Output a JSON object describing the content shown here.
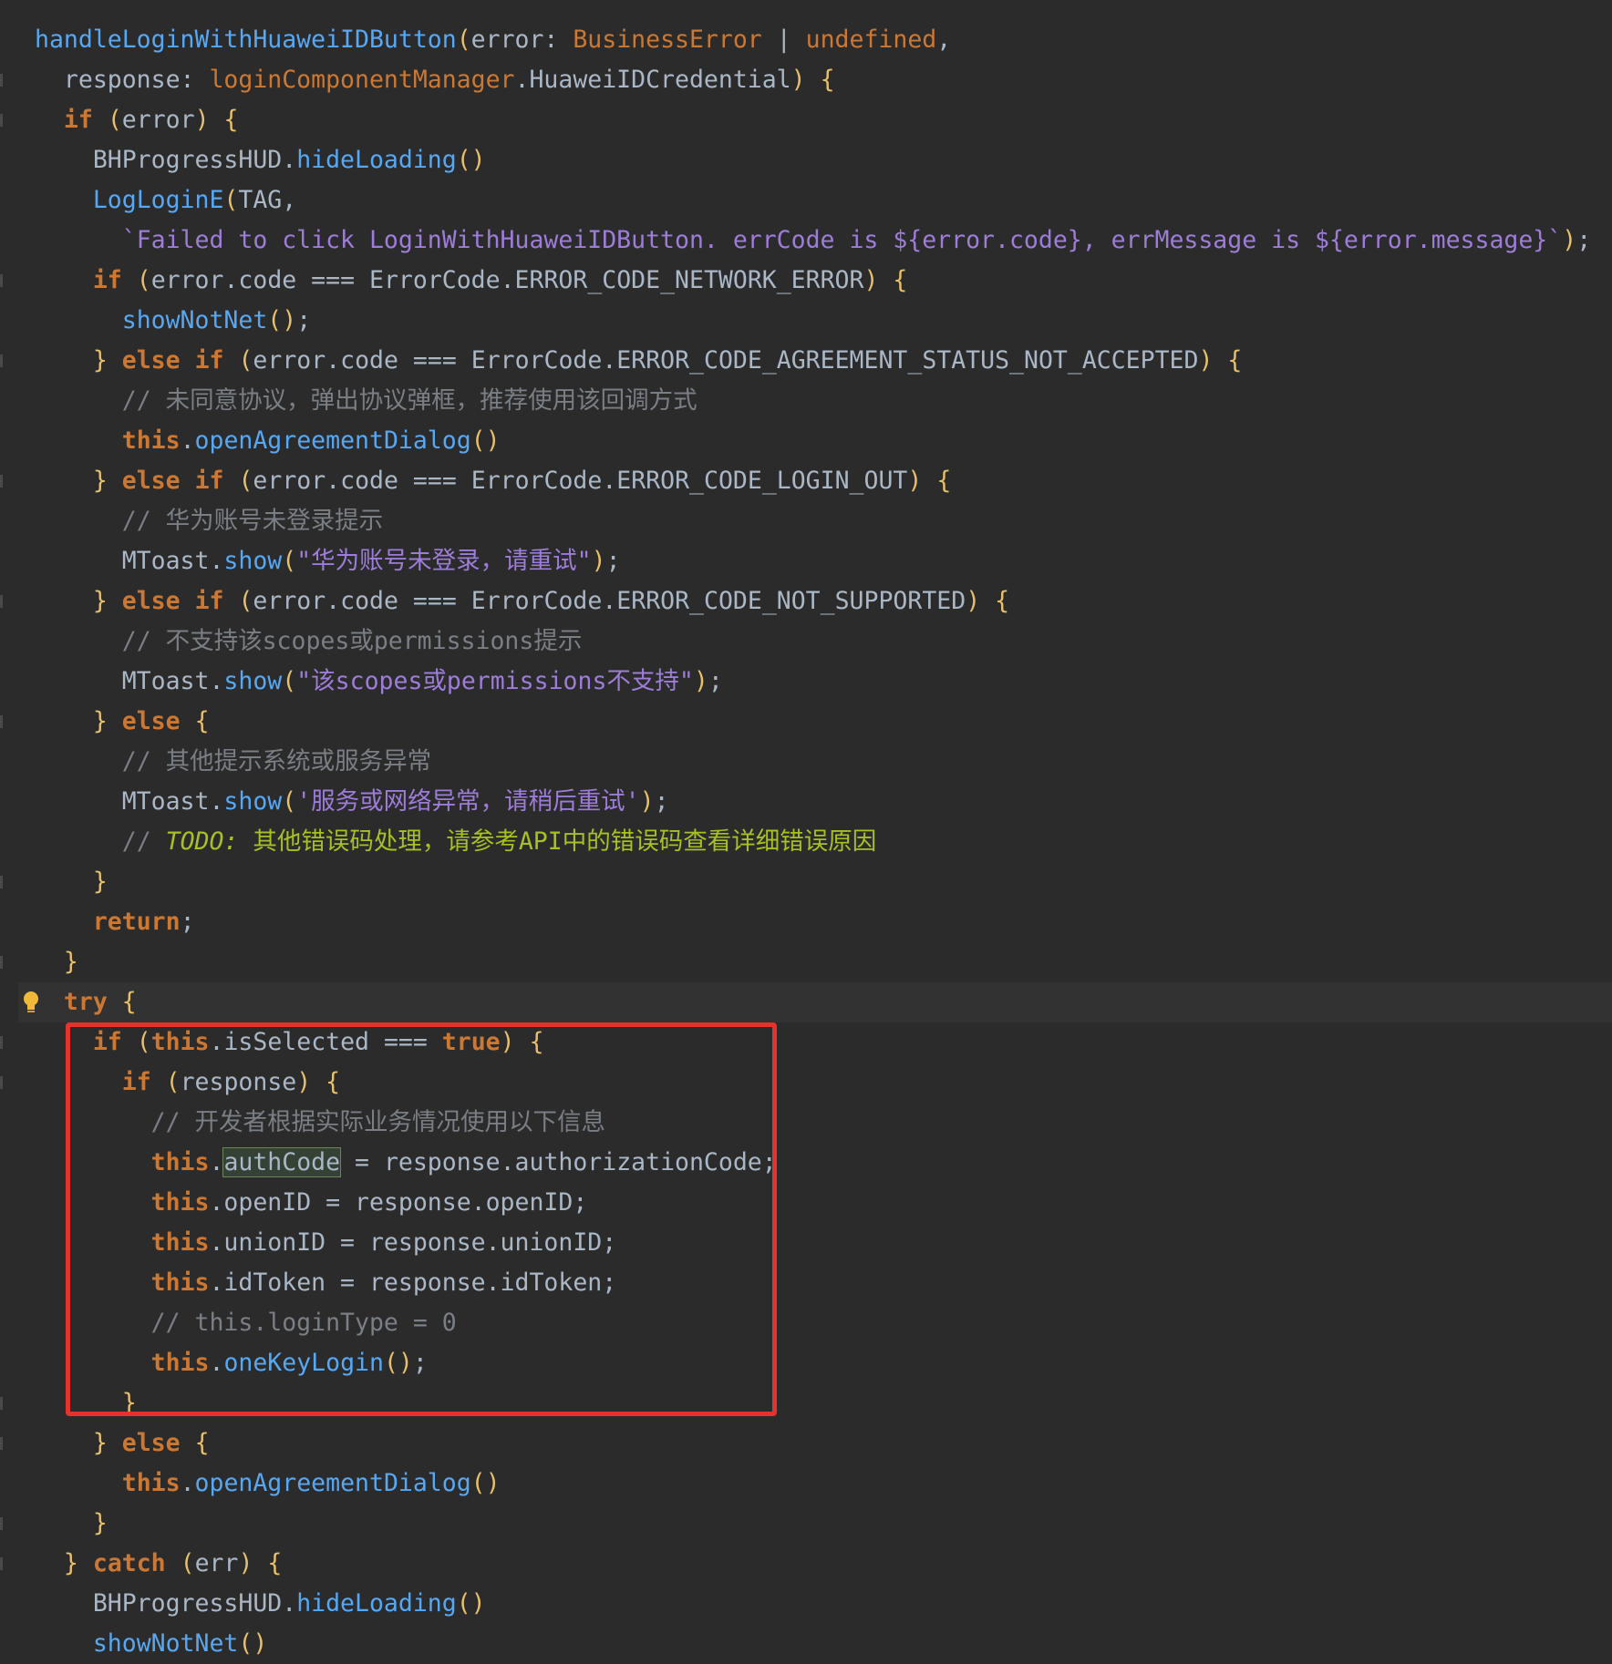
{
  "editor": {
    "theme_colors": {
      "background": "#2b2b2b",
      "keyword": "#cc7832",
      "function": "#56a8f5",
      "string": "#9e7cd9",
      "comment": "#7a7e85",
      "todo": "#a8c023",
      "annotation_box": "#e5322d"
    },
    "intention_icon": "lightbulb-icon",
    "lines": [
      "handleLoginWithHuaweiIDButton(error: BusinessError | undefined,",
      "  response: loginComponentManager.HuaweiIDCredential) {",
      "  if (error) {",
      "    BHProgressHUD.hideLoading()",
      "    LogLoginE(TAG,",
      "      `Failed to click LoginWithHuaweiIDButton. errCode is ${error.code}, errMessage is ${error.message}`);",
      "    if (error.code === ErrorCode.ERROR_CODE_NETWORK_ERROR) {",
      "      showNotNet();",
      "    } else if (error.code === ErrorCode.ERROR_CODE_AGREEMENT_STATUS_NOT_ACCEPTED) {",
      "      // 未同意协议，弹出协议弹框，推荐使用该回调方式",
      "      this.openAgreementDialog()",
      "    } else if (error.code === ErrorCode.ERROR_CODE_LOGIN_OUT) {",
      "      // 华为账号未登录提示",
      "      MToast.show(\"华为账号未登录，请重试\");",
      "    } else if (error.code === ErrorCode.ERROR_CODE_NOT_SUPPORTED) {",
      "      // 不支持该scopes或permissions提示",
      "      MToast.show(\"该scopes或permissions不支持\");",
      "    } else {",
      "      // 其他提示系统或服务异常",
      "      MToast.show('服务或网络异常，请稍后重试');",
      "      // TODO: 其他错误码处理，请参考API中的错误码查看详细错误原因",
      "    }",
      "    return;",
      "  }",
      "  try {",
      "    if (this.isSelected === true) {",
      "      if (response) {",
      "        // 开发者根据实际业务情况使用以下信息",
      "        this.authCode = response.authorizationCode;",
      "        this.openID = response.openID;",
      "        this.unionID = response.unionID;",
      "        this.idToken = response.idToken;",
      "        // this.loginType = 0",
      "        this.oneKeyLogin();",
      "      }",
      "    } else {",
      "      this.openAgreementDialog()",
      "    }",
      "  } catch (err) {",
      "    BHProgressHUD.hideLoading()",
      "    showNotNet()"
    ]
  }
}
